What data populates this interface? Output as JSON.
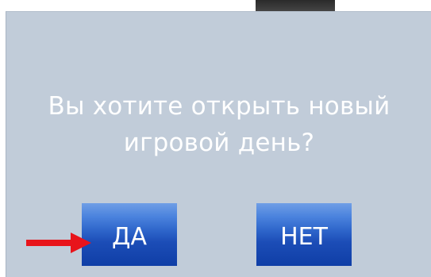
{
  "dialog": {
    "message_line1": "Вы хотите открыть новый",
    "message_line2": "игровой день?",
    "yes_label": "ДА",
    "no_label": "НЕТ"
  },
  "colors": {
    "dialog_background": "#c1ccd9",
    "button_gradient_top": "#6f9ee6",
    "button_gradient_bottom": "#0f3ea6",
    "arrow": "#e8141b",
    "text": "#ffffff"
  },
  "icons": {
    "pointer": "red-arrow-icon"
  }
}
